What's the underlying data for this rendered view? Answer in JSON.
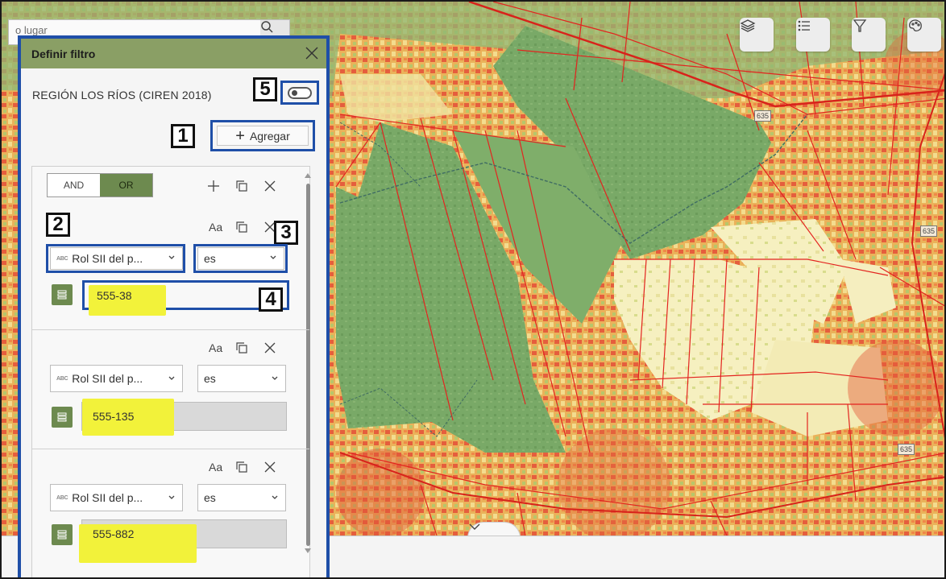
{
  "map": {
    "search_placeholder": "o lugar",
    "road_shields": [
      "635",
      "635",
      "635"
    ],
    "toolbar": [
      {
        "name": "layers-icon"
      },
      {
        "name": "legend-list-icon"
      },
      {
        "name": "filter-icon"
      },
      {
        "name": "basemap-palette-icon"
      }
    ]
  },
  "panel": {
    "title": "Definir filtro",
    "layer_name": "REGIÓN LOS RÍOS (CIREN 2018)",
    "add_label": "Agregar",
    "logic": {
      "and": "AND",
      "or": "OR",
      "selected": "OR"
    },
    "case_label": "Aa",
    "clauses": [
      {
        "field": "Rol SII del p...",
        "operator": "es",
        "value": "555-38"
      },
      {
        "field": "Rol SII del p...",
        "operator": "es",
        "value": "555-135"
      },
      {
        "field": "Rol SII del p...",
        "operator": "es",
        "value": "555-882"
      }
    ]
  },
  "annotations": [
    "1",
    "2",
    "3",
    "4",
    "5"
  ],
  "colors": {
    "panel_border": "#1f4fa8",
    "header": "#8a9f65",
    "accent": "#6d8a4f",
    "highlight": "#f2f23a"
  }
}
